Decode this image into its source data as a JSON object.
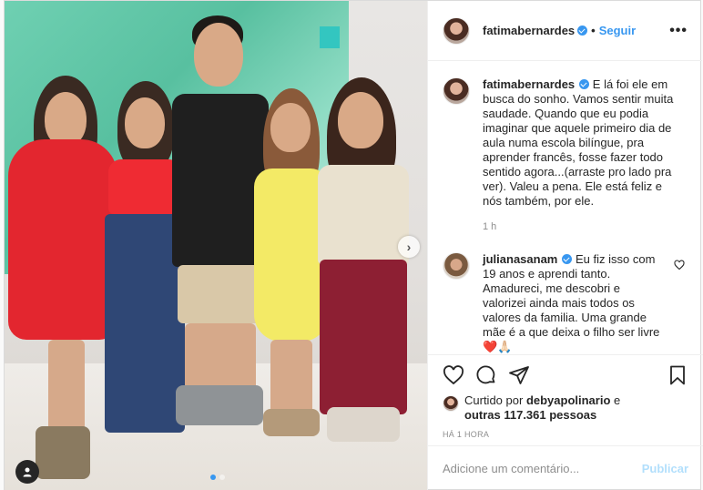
{
  "header": {
    "username": "fatimabernardes",
    "separator": "•",
    "follow_label": "Seguir",
    "more_icon": "more-horizontal-icon"
  },
  "caption": {
    "username": "fatimabernardes",
    "text": "E lá foi ele em busca do sonho. Vamos sentir muita saudade. Quando que eu podia imaginar que aquele primeiro dia de aula numa escola bilíngue, pra aprender francês, fosse fazer todo sentido agora...(arraste pro lado pra ver). Valeu a pena. Ele está feliz e nós também, por ele.",
    "time": "1 h"
  },
  "comments": [
    {
      "username": "julianasanam",
      "text": "Eu fiz isso com 19 anos e aprendi tanto. Amadureci, me descobri e valorizei ainda mais todos os valores da familia. Uma grande mãe é a que deixa o filho ser livre ❤️🙏🏻"
    }
  ],
  "actions": {
    "icons": [
      "heart-icon",
      "comment-icon",
      "share-icon",
      "bookmark-icon"
    ]
  },
  "likes": {
    "prefix": "Curtido por",
    "liker": "debyapolinario",
    "conj": "e",
    "others": "outras 117.361 pessoas"
  },
  "timestamp": "HÁ 1 HORA",
  "add_comment": {
    "placeholder": "Adicione um comentário...",
    "publish_label": "Publicar"
  },
  "carousel": {
    "next_icon": "chevron-right-icon",
    "tag_icon": "user-tag-icon",
    "slide_count": 2,
    "active_slide": 1
  },
  "colors": {
    "accent": "#3897f0",
    "publish_disabled": "#b2dffc",
    "muted": "#8e8e8e"
  }
}
